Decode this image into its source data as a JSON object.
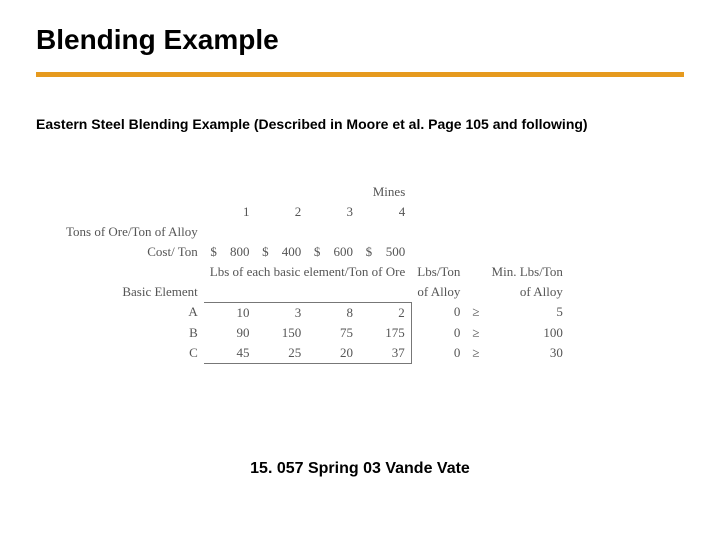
{
  "title": "Blending Example",
  "subtitle": "Eastern Steel Blending Example (Described in Moore et al. Page 105 and following)",
  "footer": "15. 057 Spring 03 Vande Vate",
  "table": {
    "mines_label": "Mines",
    "mine_numbers": [
      "1",
      "2",
      "3",
      "4"
    ],
    "row1_label": "Tons of Ore/Ton of Alloy",
    "cost_label": "Cost/ Ton",
    "currency": "$",
    "costs": [
      "800",
      "400",
      "600",
      "500"
    ],
    "mid_label": "Lbs of each basic element/Ton of Ore",
    "col_lbs_label1": "Lbs/Ton",
    "col_lbs_label2": "of Alloy",
    "col_min_label1": "Min. Lbs/Ton",
    "col_min_label2": "of Alloy",
    "basic_element_label": "Basic Element",
    "elements": [
      {
        "name": "A",
        "v": [
          "10",
          "3",
          "8",
          "2"
        ],
        "lbs": "0",
        "rel": "≥",
        "min": "5"
      },
      {
        "name": "B",
        "v": [
          "90",
          "150",
          "75",
          "175"
        ],
        "lbs": "0",
        "rel": "≥",
        "min": "100"
      },
      {
        "name": "C",
        "v": [
          "45",
          "25",
          "20",
          "37"
        ],
        "lbs": "0",
        "rel": "≥",
        "min": "30"
      }
    ]
  }
}
